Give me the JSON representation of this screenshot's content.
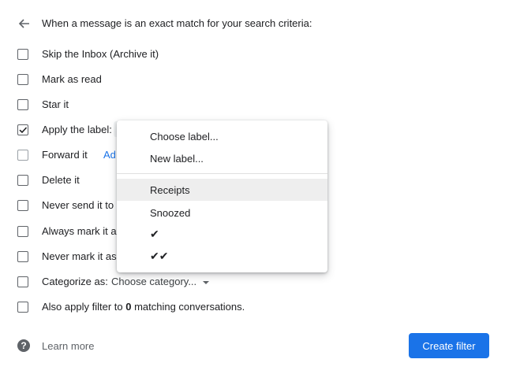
{
  "header": {
    "text": "When a message is an exact match for your search criteria:"
  },
  "options": {
    "skip_inbox": "Skip the Inbox (Archive it)",
    "mark_read": "Mark as read",
    "star": "Star it",
    "apply_label": "Apply the label:",
    "forward": "Forward it",
    "forward_link": "Ad",
    "delete": "Delete it",
    "never_spam": "Never send it to S",
    "always_important": "Always mark it as",
    "never_important": "Never mark it as",
    "categorize": "Categorize as:",
    "category_value": "Choose category...",
    "also_apply_prefix": "Also apply filter to ",
    "also_apply_count": "0",
    "also_apply_suffix": " matching conversations."
  },
  "checked": {
    "apply_label": true
  },
  "label_menu": {
    "items": [
      "Choose label...",
      "New label...",
      "Receipts",
      "Snoozed",
      "✔",
      "✔✔"
    ],
    "highlighted": "Receipts"
  },
  "footer": {
    "learn_more": "Learn more",
    "create_button": "Create filter"
  },
  "colors": {
    "accent": "#1a73e8",
    "text": "#202124",
    "secondary": "#5f6368"
  },
  "icons": {
    "back": "arrow-left-icon",
    "help": "help-circle-icon",
    "checkbox": "checkbox-icon",
    "dropdown": "triangle-down-icon"
  }
}
